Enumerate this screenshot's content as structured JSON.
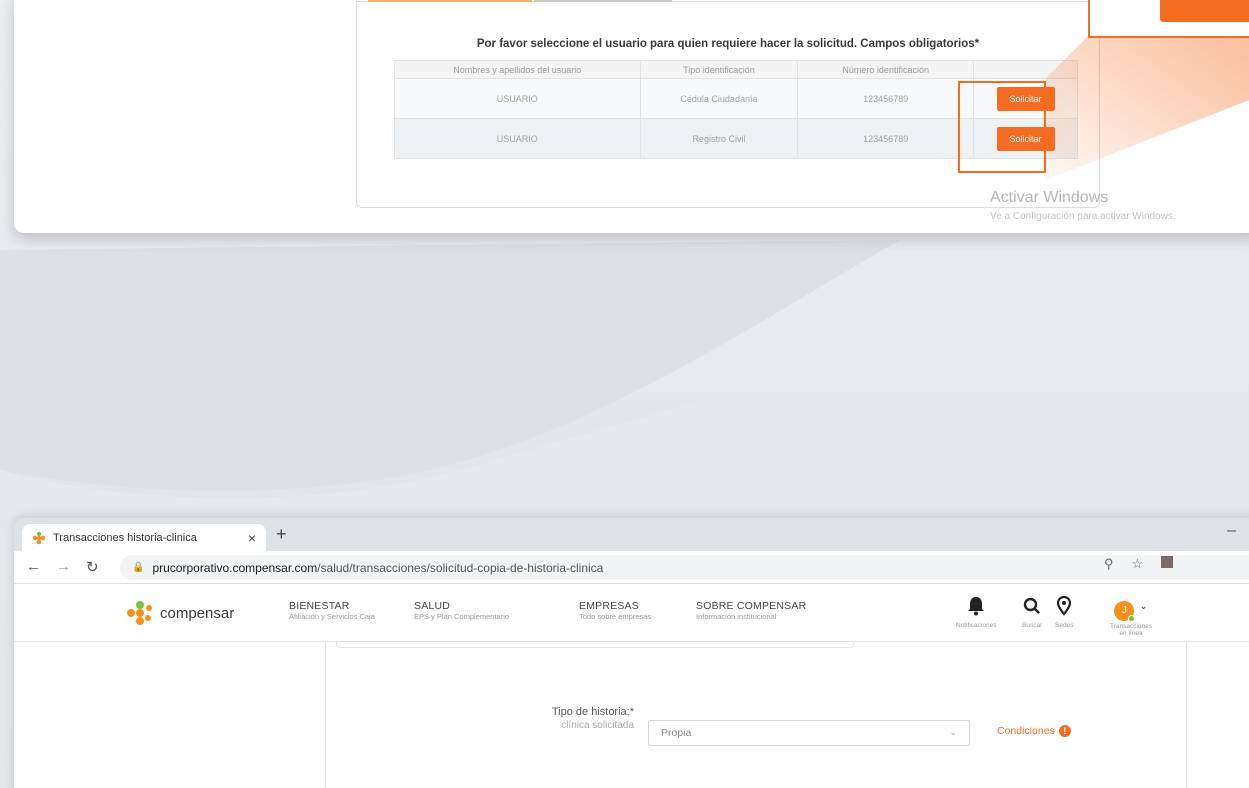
{
  "top_panel": {
    "instruction": "Por favor seleccione el usuario para quien requiere hacer la solicitud. Campos obligatorios*",
    "columns": [
      "Nombres y apellidos del usuario",
      "Tipo identificación",
      "Número identificación",
      ""
    ],
    "rows": [
      {
        "name": "USUARIO",
        "id_type": "Cédula Ciudadanía",
        "id_number": "123456789",
        "action": "Solicitar"
      },
      {
        "name": "USUARIO",
        "id_type": "Registro Civil",
        "id_number": "123456789",
        "action": "Solicitar"
      }
    ],
    "watermark_title": "Activar Windows",
    "watermark_sub": "Ve a Configuración para activar Windows."
  },
  "browser": {
    "tab_title": "Transacciones historia-clinica",
    "tab_close": "×",
    "new_tab": "+",
    "minimize": "–",
    "url_host": "prucorporativo.compensar.com",
    "url_path": "/salud/transacciones/solicitud-copia-de-historia-clinica"
  },
  "site": {
    "logo_text": "compensar",
    "menu": [
      {
        "title": "BIENESTAR",
        "sub": "Afiliación y Servicios Caja"
      },
      {
        "title": "SALUD",
        "sub": "EPS y Plan Complementario"
      },
      {
        "title": "EMPRESAS",
        "sub": "Todo sobre empresas"
      },
      {
        "title": "SOBRE COMPENSAR",
        "sub": "Información institucional"
      }
    ],
    "icons": {
      "notificaciones": "Notificaciones",
      "buscar": "Buscar",
      "sedes": "Sedes",
      "transacciones_1": "Transacciones",
      "transacciones_2": "en línea"
    },
    "avatar_initial": "J"
  },
  "form": {
    "tipo_label": "Tipo de historia:*",
    "tipo_sublabel": "clínica solicitada",
    "tipo_value": "Propia",
    "condiciones": "Condiciones",
    "info_glyph": "!"
  },
  "colors": {
    "accent": "#f36c21",
    "logo_orange": "#f5901e",
    "logo_green": "#7ac142"
  }
}
